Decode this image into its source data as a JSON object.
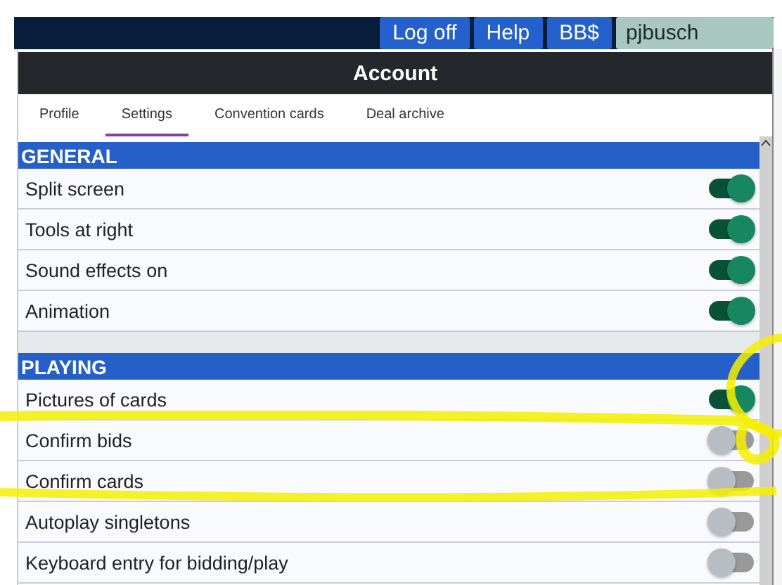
{
  "top_bar": {
    "buttons": [
      "Log off",
      "Help",
      "BB$"
    ],
    "username": "pjbusch"
  },
  "panel": {
    "title": "Account"
  },
  "tabs": [
    {
      "label": "Profile",
      "selected": false
    },
    {
      "label": "Settings",
      "selected": true
    },
    {
      "label": "Convention cards",
      "selected": false
    },
    {
      "label": "Deal archive",
      "selected": false
    }
  ],
  "sections": [
    {
      "title": "GENERAL",
      "settings": [
        {
          "label": "Split screen",
          "on": true
        },
        {
          "label": "Tools at right",
          "on": true
        },
        {
          "label": "Sound effects on",
          "on": true
        },
        {
          "label": "Animation",
          "on": true
        }
      ]
    },
    {
      "title": "PLAYING",
      "settings": [
        {
          "label": "Pictures of cards",
          "on": true
        },
        {
          "label": "Confirm bids",
          "on": false
        },
        {
          "label": "Confirm cards",
          "on": false
        },
        {
          "label": "Autoplay singletons",
          "on": false
        },
        {
          "label": "Keyboard entry for bidding/play",
          "on": false
        }
      ]
    }
  ]
}
